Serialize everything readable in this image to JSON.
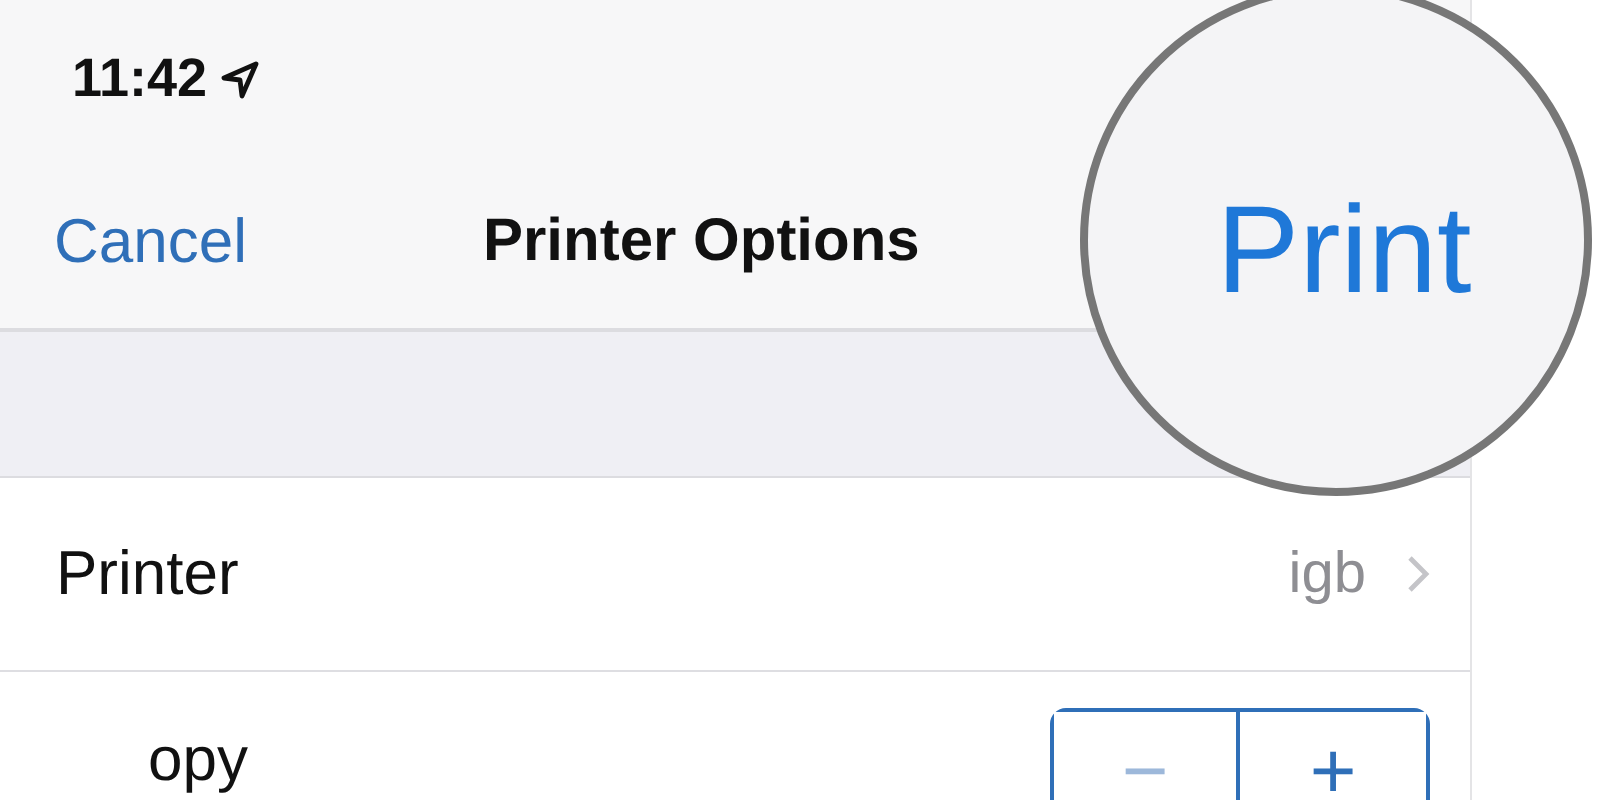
{
  "status_bar": {
    "time": "11:42"
  },
  "nav_bar": {
    "cancel": "Cancel",
    "title": "Printer Options",
    "print": "Print"
  },
  "rows": [
    {
      "kind": "link",
      "label": "Printer",
      "value": "igb"
    },
    {
      "kind": "stepper",
      "label": "opy",
      "buttons": [
        {
          "label": "−",
          "disabled": true
        },
        {
          "label": "+",
          "disabled": false
        }
      ]
    }
  ]
}
